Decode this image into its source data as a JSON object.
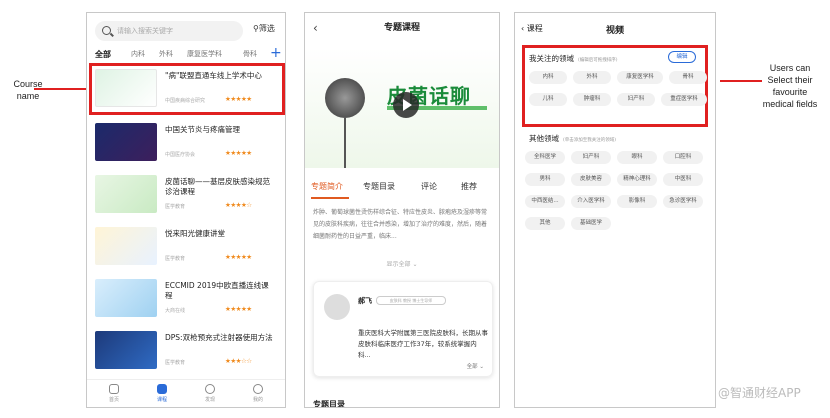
{
  "annotations": {
    "course_name": [
      "Course",
      "name"
    ],
    "favourite_fields": [
      "Users can",
      "Select their",
      "favourite",
      "medical fields"
    ]
  },
  "phone1": {
    "search_placeholder": "请输入搜索关键字",
    "filter_label": "筛选",
    "tabs": [
      "全部",
      "内科",
      "外科",
      "康复医学科",
      "骨科"
    ],
    "add_tab_icon": "plus-icon",
    "courses": [
      {
        "title": "\"病\"联盟直通车线上学术中心",
        "meta": "中国疾病综合研究",
        "stars": "★★★★★"
      },
      {
        "title": "中国关节炎与疼痛管理",
        "meta": "中国医疗协会",
        "stars": "★★★★★"
      },
      {
        "title": "皮菌话聊——基层皮肤感染规范诊治课程",
        "meta": "医学教育",
        "stars": "★★★★☆"
      },
      {
        "title": "悦来阳光健康讲堂",
        "meta": "医学教育",
        "stars": "★★★★★"
      },
      {
        "title": "ECCMID 2019中欧直播连线课程",
        "meta": "大商在线",
        "stars": "★★★★★"
      },
      {
        "title": "DPS:双枪预充式注射器使用方法",
        "meta": "医学教育",
        "stars": "★★★☆☆"
      }
    ],
    "nav": [
      "首页",
      "课程",
      "发现",
      "我的"
    ]
  },
  "phone2": {
    "title": "专题课程",
    "video_title": "皮菌话聊",
    "tabs": [
      "专题简介",
      "专题目录",
      "评论",
      "推荐"
    ],
    "description": "炸肿、葡萄球菌性烫伤样综合征、特应性皮炎、脓疱疮及湿疹等常见的皮肤科疾病，往往合并感染，增加了治疗的难度，然后，随着细菌耐药性的日益严重，临床...",
    "show_all": "显示全部",
    "doctor": {
      "name": "郝飞",
      "tag": "皮肤科 教授 博士生导师",
      "bio": "重庆医科大学附属第三医院皮肤科，长期从事皮肤科临床医疗工作37年，较系统掌握内科...",
      "more": "全部"
    },
    "section_label": "专题目录"
  },
  "phone3": {
    "back_label": "课程",
    "title": "视频",
    "favourite_heading": "我关注的领域",
    "favourite_note": "(编辑后可拖拽排序)",
    "edit_label": "编辑",
    "favourite_chips": [
      "内科",
      "外科",
      "康复医学科",
      "骨科",
      "儿科",
      "肿瘤科",
      "妇产科",
      "重症医学科"
    ],
    "other_heading": "其他领域",
    "other_note": "(单击添加至我关注的领域)",
    "other_chips": [
      "全科医学",
      "妇产科",
      "眼科",
      "口腔科",
      "男科",
      "皮肤美容",
      "精神心理科",
      "中医科",
      "中西医结...",
      "介入医学科",
      "影像科",
      "急诊医学科",
      "其他",
      "基础医学"
    ]
  },
  "watermark": "@智通财经APP",
  "colors": {
    "accent": "#2a6bd8",
    "highlight": "#e02020",
    "star": "#f08a1c",
    "brand_green": "#1a8b3a"
  }
}
